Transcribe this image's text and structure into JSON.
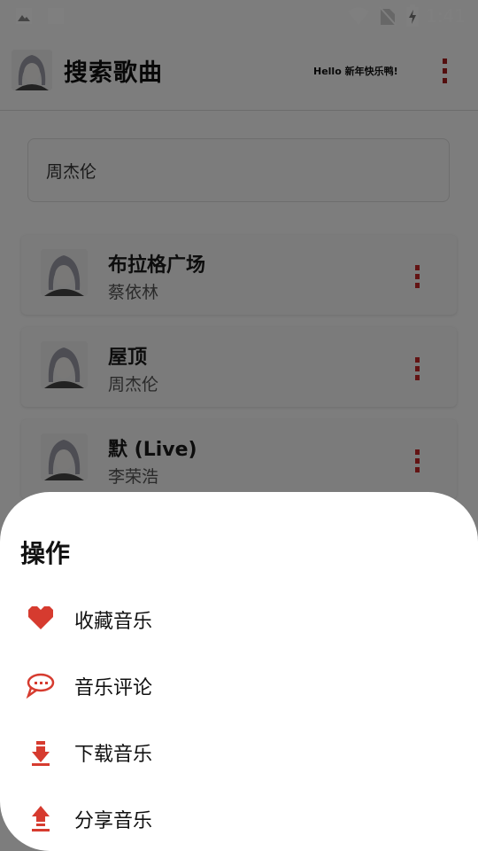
{
  "status_bar": {
    "time": "1:41",
    "icons": [
      "image-icon",
      "square-icon",
      "wifi-icon",
      "no-sim-icon",
      "battery-charging-icon"
    ]
  },
  "app_bar": {
    "title": "搜索歌曲",
    "greeting": "Hello 新年快乐鸭!",
    "menu_icon": "more-vertical-icon"
  },
  "search": {
    "value": "周杰伦"
  },
  "songs": [
    {
      "title": "布拉格广场",
      "artist": "蔡依林"
    },
    {
      "title": "屋顶",
      "artist": "周杰伦"
    },
    {
      "title": "默 (Live)",
      "artist": "李荣浩"
    }
  ],
  "sheet": {
    "title": "操作",
    "actions": [
      {
        "label": "收藏音乐",
        "icon": "heart-icon"
      },
      {
        "label": "音乐评论",
        "icon": "comment-icon"
      },
      {
        "label": "下载音乐",
        "icon": "download-icon"
      },
      {
        "label": "分享音乐",
        "icon": "share-icon"
      }
    ]
  },
  "colors": {
    "accent": "#d63b2f",
    "menu_dots": "#a81c1c",
    "scrim": "rgba(0,0,0,0.5)"
  }
}
